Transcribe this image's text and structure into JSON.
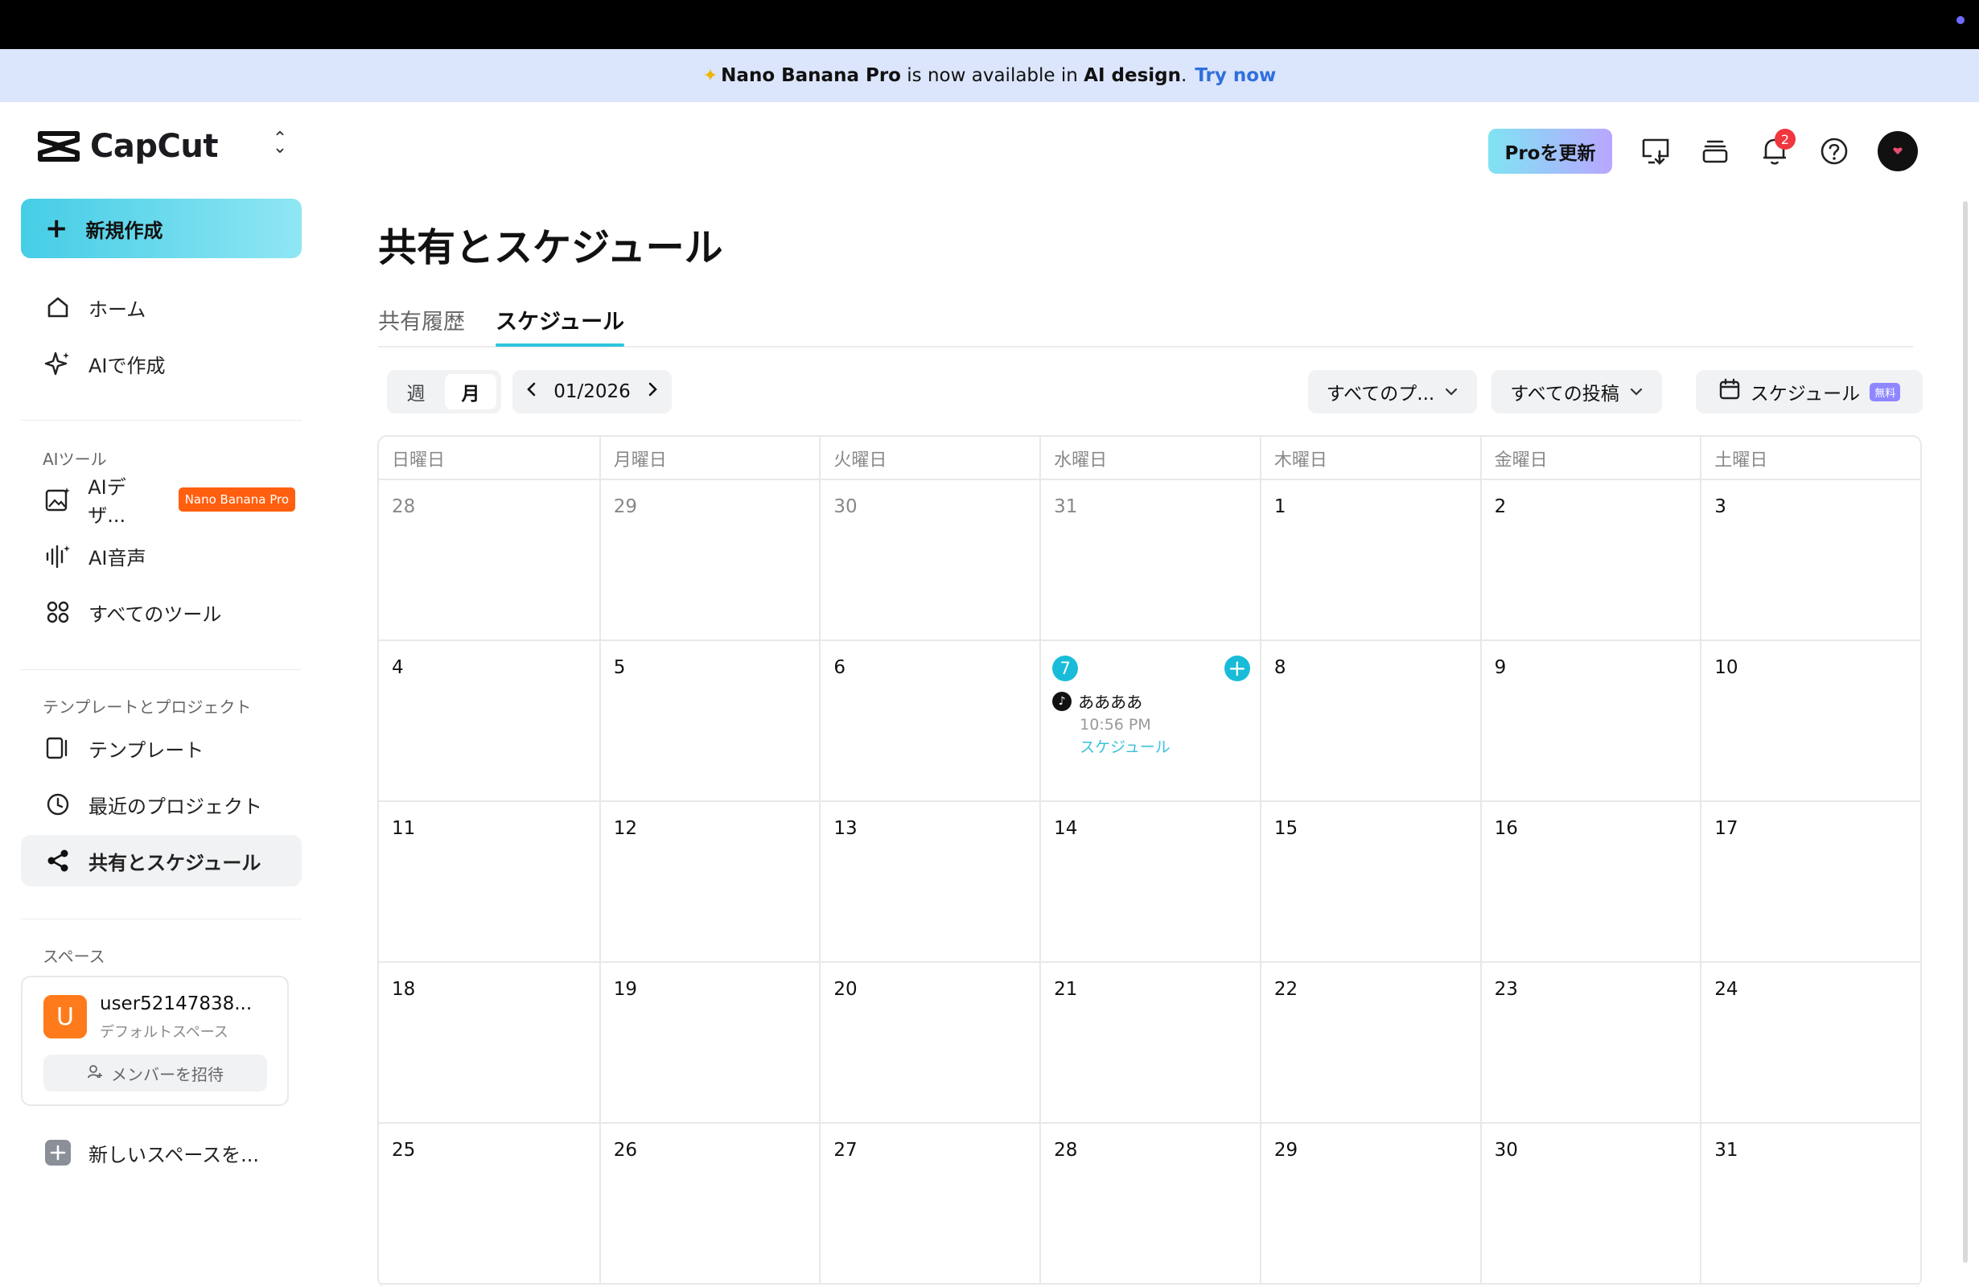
{
  "banner": {
    "product": "Nano Banana Pro",
    "middle": "is now available in",
    "feature": "AI design",
    "period": ".",
    "link": "Try now"
  },
  "sidebar": {
    "logo": "CapCut",
    "new_label": "新規作成",
    "home": "ホーム",
    "ai_create": "AIで作成",
    "section_ai_tools": "AIツール",
    "ai_design": "AIデザ...",
    "ai_design_badge": "Nano Banana Pro",
    "ai_voice": "AI音声",
    "all_tools": "すべてのツール",
    "section_templates": "テンプレートとプロジェクト",
    "templates": "テンプレート",
    "recent_projects": "最近のプロジェクト",
    "share_schedule": "共有とスケジュール",
    "section_space": "スペース",
    "space": {
      "avatar_letter": "U",
      "name": "user52147838...",
      "sub": "デフォルトスペース",
      "invite": "メンバーを招待"
    },
    "new_space": "新しいスペースを..."
  },
  "header": {
    "pro_label": "Proを更新",
    "notification_count": "2"
  },
  "main": {
    "title": "共有とスケジュール",
    "tabs": [
      "共有履歴",
      "スケジュール"
    ],
    "view_week": "週",
    "view_month": "月",
    "month": "01/2026",
    "filter_platform": "すべてのプ...",
    "filter_posts": "すべての投稿",
    "schedule_btn": "スケジュール",
    "free_badge": "無料"
  },
  "calendar": {
    "weekdays": [
      "日曜日",
      "月曜日",
      "火曜日",
      "水曜日",
      "木曜日",
      "金曜日",
      "土曜日"
    ],
    "weeks": [
      [
        "28",
        "29",
        "30",
        "31",
        "1",
        "2",
        "3"
      ],
      [
        "4",
        "5",
        "6",
        "7",
        "8",
        "9",
        "10"
      ],
      [
        "11",
        "12",
        "13",
        "14",
        "15",
        "16",
        "17"
      ],
      [
        "18",
        "19",
        "20",
        "21",
        "22",
        "23",
        "24"
      ],
      [
        "25",
        "26",
        "27",
        "28",
        "29",
        "30",
        "31"
      ]
    ],
    "muted_first_row_count": 4,
    "today": "7",
    "event": {
      "title": "ああああ",
      "time": "10:56 PM",
      "status": "スケジュール"
    }
  },
  "colors": {
    "accent": "#19bcd8",
    "badge_orange": "#ff5f0f",
    "notif_red": "#f0363f"
  }
}
